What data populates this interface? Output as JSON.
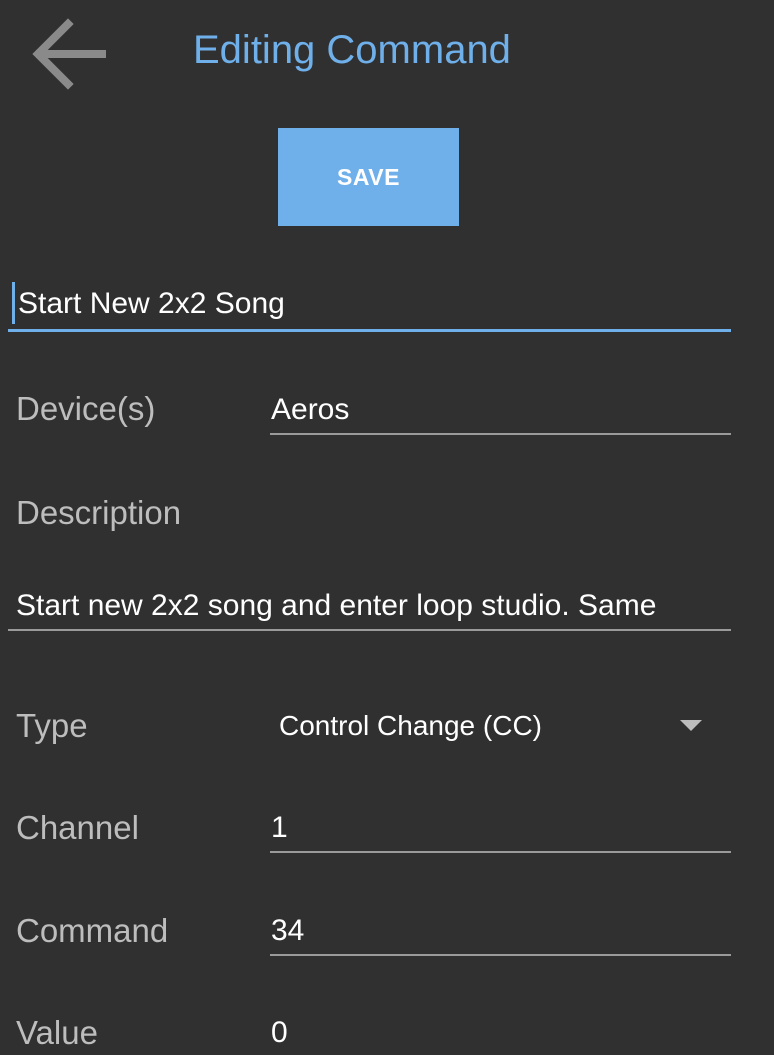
{
  "header": {
    "back_icon": "arrow-left-icon",
    "title": "Editing Command"
  },
  "toolbar": {
    "save_label": "SAVE"
  },
  "form": {
    "name_value": "Start New 2x2 Song",
    "devices_label": "Device(s)",
    "devices_value": "Aeros",
    "description_label": "Description",
    "description_value": "Start new 2x2 song and enter loop studio. Same",
    "type_label": "Type",
    "type_value": "Control Change (CC)",
    "type_dropdown_icon": "triangle-down-icon",
    "channel_label": "Channel",
    "channel_value": "1",
    "command_label": "Command",
    "command_value": "34",
    "value_label": "Value",
    "value_value": "0"
  },
  "colors": {
    "background": "#303030",
    "accent": "#6fb0ea",
    "label": "#bdbdbd",
    "underline": "#9a9a9a"
  }
}
